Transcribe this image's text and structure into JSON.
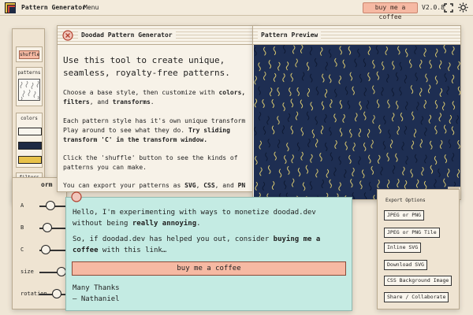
{
  "topbar": {
    "app_title": "Pattern Generator",
    "menu": "Menu",
    "coffee": "buy me a coffee",
    "version": "V2.0.8"
  },
  "sidebar": {
    "shuffle": "shuffle",
    "patterns_label": "patterns",
    "colors_label": "colors",
    "colors": [
      "#f8f5ee",
      "#1e2a44",
      "#e8c24a"
    ],
    "filters_label": "filters",
    "add": "add"
  },
  "intro": {
    "title": "Doodad Pattern Generator",
    "lead": "Use this tool to create unique, seamless, royalty-free patterns.",
    "p1_a": "Choose a base style, then customize with ",
    "p1_b": "colors,",
    "p1_c": "filters",
    "p1_d": ", and ",
    "p1_e": "transforms",
    "p1_f": ".",
    "p2_a": "Each pattern style has it's own unique transform",
    "p2_b": "Play around to see what they do. ",
    "p2_c": "Try sliding",
    "p2_d": "transform 'C' in the transform window.",
    "p3_a": "Click the 'shuffle' button to see the kinds of",
    "p3_b": "patterns you can make.",
    "p4_a": "You can export your patterns as ",
    "p4_b": "SVG",
    "p4_c": ", ",
    "p4_d": "CSS",
    "p4_e": ", and ",
    "p4_f": "PN"
  },
  "preview": {
    "title": "Pattern Preview",
    "bg_color": "#1e2e52",
    "stroke_color": "#d7c770"
  },
  "controls": {
    "sliders": [
      {
        "label": "A",
        "value": 0.35
      },
      {
        "label": "B",
        "value": 0.25
      },
      {
        "label": "C",
        "value": 0.2
      },
      {
        "label": "size",
        "value": 0.7
      },
      {
        "label": "rotation",
        "value": 0.55
      }
    ],
    "partial_title": "orm"
  },
  "donate": {
    "p1_a": "Hello, I'm experimenting with ways to monetize doodad.dev",
    "p1_b": "without being ",
    "p1_c": "really annoying",
    "p1_d": ".",
    "p2_a": "So, if doodad.dev has helped you out, consider ",
    "p2_b": "buying me a",
    "p2_c": "coffee",
    "p2_d": " with this link…",
    "button": "buy me a coffee",
    "thanks": "Many Thanks",
    "sign": "— Nathaniel"
  },
  "export": {
    "label": "Export Options",
    "buttons": [
      "JPEG or PNG",
      "JPEG or PNG Tile",
      "Inline SVG",
      "Download SVG",
      "CSS Background Image",
      "Share / Collaborate"
    ]
  }
}
